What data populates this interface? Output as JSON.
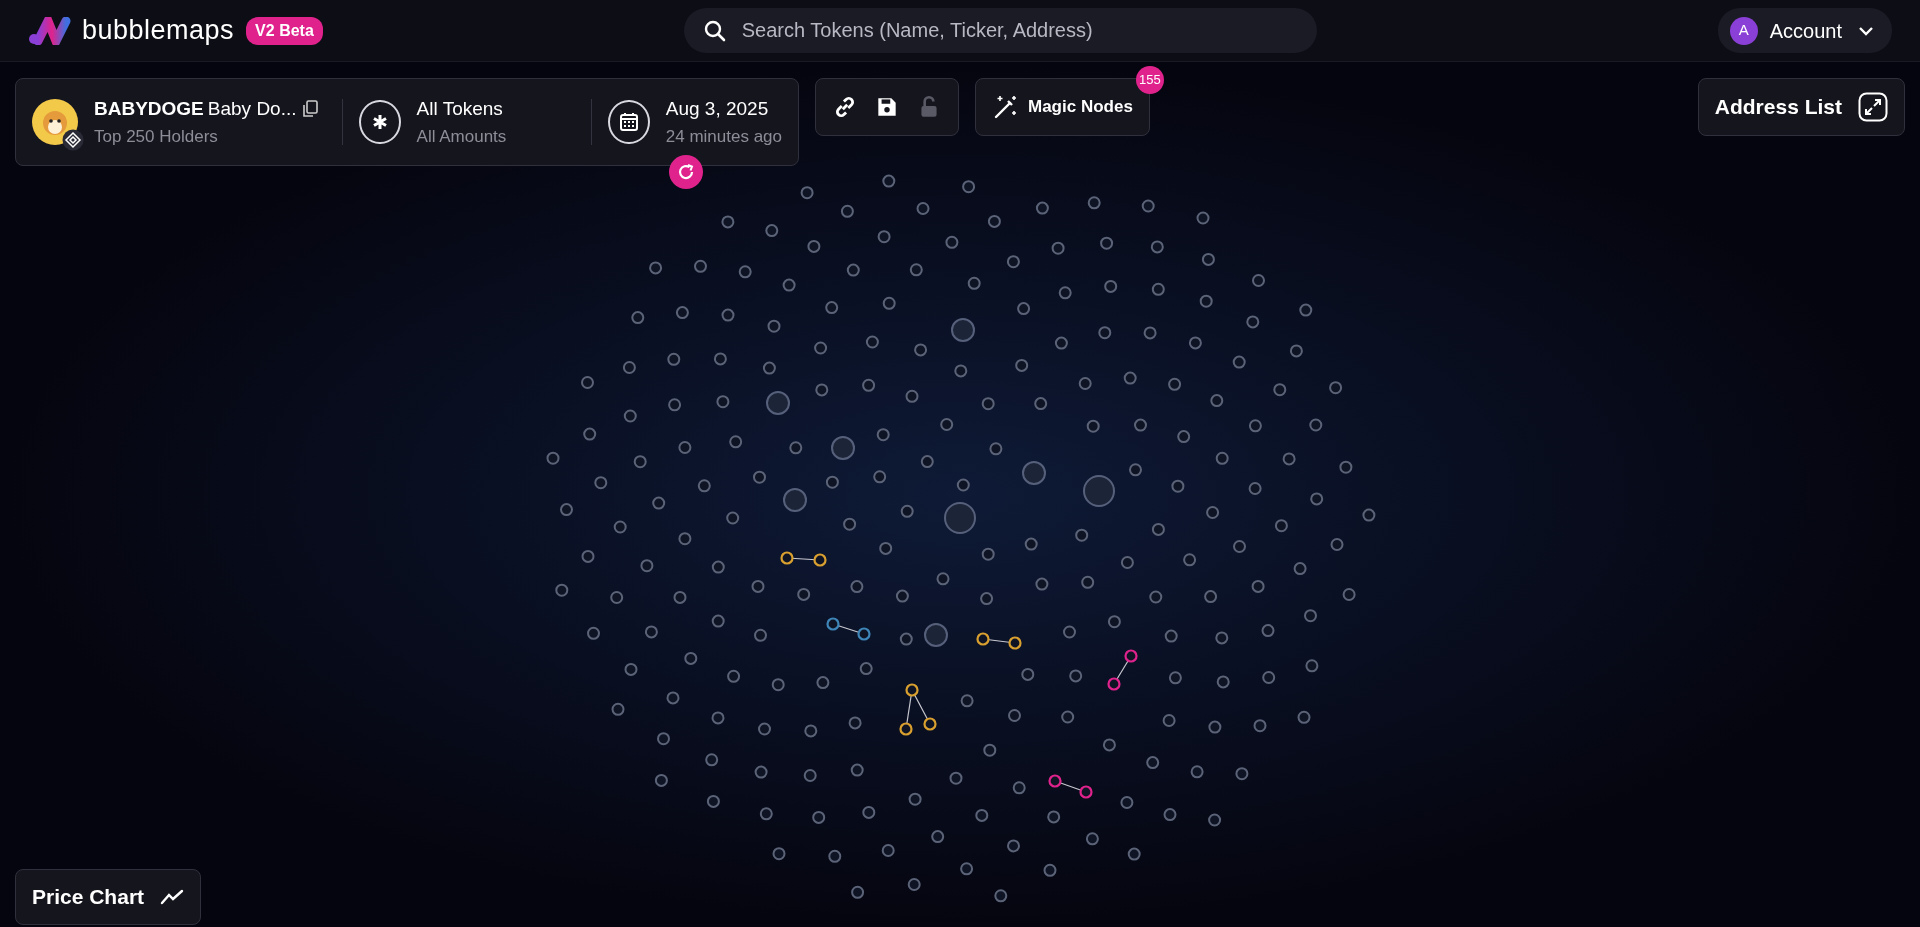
{
  "brand": {
    "name": "bubblemaps",
    "badge": "V2 Beta"
  },
  "search": {
    "placeholder": "Search Tokens (Name, Ticker, Address)"
  },
  "account": {
    "avatar": "A",
    "label": "Account"
  },
  "token": {
    "ticker": "BABYDOGE",
    "name": "Baby Do...",
    "subtitle": "Top 250 Holders"
  },
  "filter": {
    "title": "All Tokens",
    "subtitle": "All Amounts"
  },
  "date": {
    "title": "Aug 3, 2025",
    "subtitle": "24 minutes ago"
  },
  "tools": [
    {
      "kind": "link",
      "disabled": false
    },
    {
      "kind": "save",
      "disabled": false
    },
    {
      "kind": "lock",
      "disabled": true
    }
  ],
  "magic_nodes": {
    "label": "Magic Nodes",
    "count": "155"
  },
  "address_list": {
    "label": "Address List"
  },
  "price_chart": {
    "label": "Price Chart"
  },
  "clusters": [
    {
      "kind": "pair",
      "color": "#d9a030"
    },
    {
      "kind": "pair",
      "color": "#3f86b8"
    },
    {
      "kind": "pair",
      "color": "#d9a030"
    },
    {
      "kind": "pair",
      "color": "#e0238c"
    },
    {
      "kind": "triple",
      "color": "#d9a030"
    },
    {
      "kind": "pair",
      "color": "#e0238c"
    }
  ]
}
